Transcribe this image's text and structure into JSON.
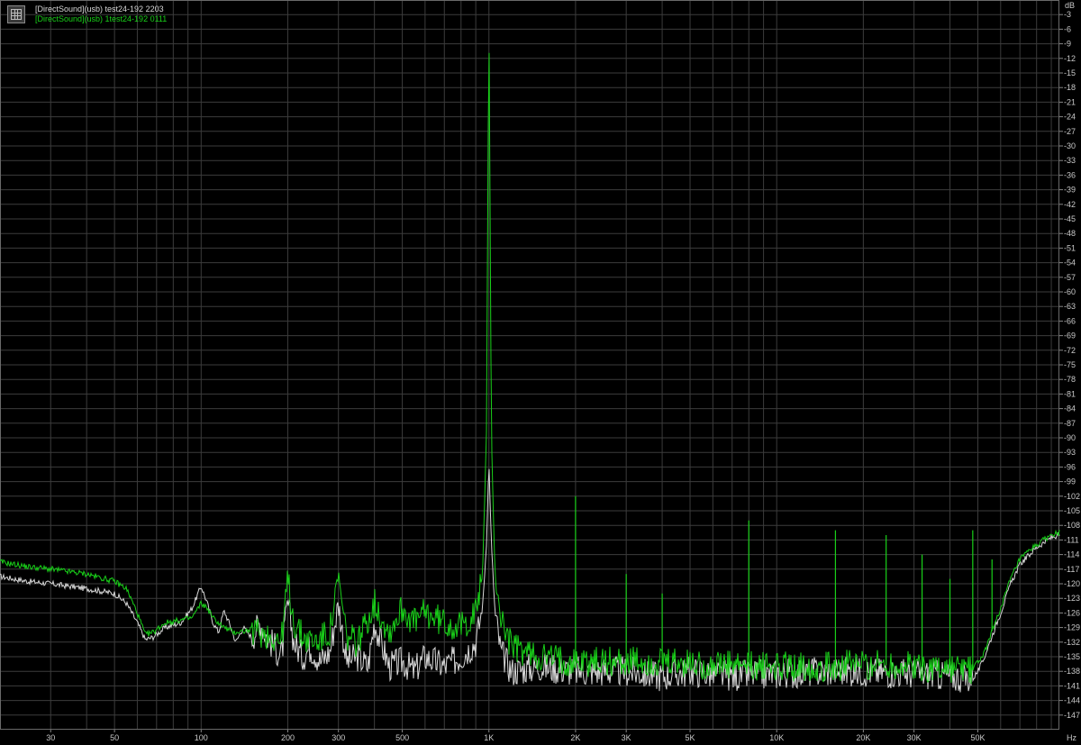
{
  "legend": {
    "series0": "[DirectSound](usb) test24-192 2203",
    "series1": "[DirectSound](usb) 1test24-192 0111"
  },
  "chart_data": {
    "type": "line",
    "xscale": "log",
    "xlim": [
      20,
      96000
    ],
    "ylim": [
      -150,
      0
    ],
    "grid": true,
    "legend_position": "top-left",
    "x_unit": "Hz",
    "y_unit": "dB",
    "x_ticks": [
      30,
      50,
      100,
      200,
      300,
      500,
      1000,
      2000,
      3000,
      5000,
      10000,
      20000,
      30000,
      50000
    ],
    "x_tick_labels": [
      "30",
      "50",
      "100",
      "200",
      "300",
      "500",
      "1K",
      "2K",
      "3K",
      "5K",
      "10K",
      "20K",
      "30K",
      "50K"
    ],
    "y_ticks": [
      -3,
      -6,
      -9,
      -12,
      -15,
      -18,
      -21,
      -24,
      -27,
      -30,
      -33,
      -36,
      -39,
      -42,
      -45,
      -48,
      -51,
      -54,
      -57,
      -60,
      -63,
      -66,
      -69,
      -72,
      -75,
      -78,
      -81,
      -84,
      -87,
      -90,
      -93,
      -96,
      -99,
      -102,
      -105,
      -108,
      -111,
      -114,
      -117,
      -120,
      -123,
      -126,
      -129,
      -132,
      -135,
      -138,
      -141,
      -144,
      -147
    ],
    "series": [
      {
        "name": "[DirectSound](usb) test24-192 2203",
        "color": "#d8d8d8",
        "points": [
          [
            20,
            -118.5
          ],
          [
            25,
            -119.5
          ],
          [
            30,
            -120
          ],
          [
            40,
            -121
          ],
          [
            50,
            -122
          ],
          [
            55,
            -124
          ],
          [
            60,
            -128
          ],
          [
            64,
            -131.5
          ],
          [
            68,
            -131
          ],
          [
            75,
            -129
          ],
          [
            85,
            -128
          ],
          [
            93,
            -125
          ],
          [
            100,
            -120.5
          ],
          [
            105,
            -124
          ],
          [
            110,
            -128
          ],
          [
            115,
            -130
          ],
          [
            120,
            -125.5
          ],
          [
            125,
            -128
          ],
          [
            132,
            -132
          ],
          [
            140,
            -129
          ],
          [
            150,
            -131
          ],
          [
            160,
            -128
          ],
          [
            170,
            -131
          ],
          [
            180,
            -133
          ],
          [
            190,
            -135
          ],
          [
            200,
            -124
          ],
          [
            210,
            -132
          ],
          [
            225,
            -135
          ],
          [
            240,
            -133
          ],
          [
            260,
            -136
          ],
          [
            280,
            -134
          ],
          [
            300,
            -124
          ],
          [
            320,
            -136
          ],
          [
            350,
            -135
          ],
          [
            380,
            -137
          ],
          [
            400,
            -128
          ],
          [
            450,
            -137
          ],
          [
            500,
            -136
          ],
          [
            550,
            -138
          ],
          [
            600,
            -135
          ],
          [
            700,
            -137
          ],
          [
            800,
            -135
          ],
          [
            900,
            -132
          ],
          [
            950,
            -125
          ],
          [
            980,
            -112
          ],
          [
            1000,
            -95
          ],
          [
            1020,
            -112
          ],
          [
            1050,
            -126
          ],
          [
            1100,
            -134
          ],
          [
            1200,
            -138
          ],
          [
            1500,
            -137
          ],
          [
            2000,
            -138
          ],
          [
            3000,
            -138
          ],
          [
            4000,
            -139
          ],
          [
            5000,
            -138
          ],
          [
            7000,
            -139
          ],
          [
            10000,
            -138.5
          ],
          [
            15000,
            -138
          ],
          [
            20000,
            -138
          ],
          [
            30000,
            -138.5
          ],
          [
            40000,
            -139
          ],
          [
            48000,
            -139.5
          ],
          [
            50000,
            -138
          ],
          [
            52000,
            -136
          ],
          [
            55000,
            -132
          ],
          [
            60000,
            -126
          ],
          [
            65000,
            -120
          ],
          [
            70000,
            -116
          ],
          [
            80000,
            -112.5
          ],
          [
            90000,
            -110.5
          ],
          [
            96000,
            -110
          ]
        ]
      },
      {
        "name": "[DirectSound](usb) 1test24-192 0111",
        "color": "#19d019",
        "points": [
          [
            20,
            -115.5
          ],
          [
            25,
            -116.5
          ],
          [
            30,
            -117
          ],
          [
            40,
            -118
          ],
          [
            50,
            -119.5
          ],
          [
            55,
            -121
          ],
          [
            60,
            -126
          ],
          [
            64,
            -130.5
          ],
          [
            68,
            -130
          ],
          [
            75,
            -128
          ],
          [
            85,
            -127.5
          ],
          [
            93,
            -127
          ],
          [
            100,
            -124
          ],
          [
            105,
            -125
          ],
          [
            110,
            -127
          ],
          [
            120,
            -129
          ],
          [
            130,
            -130
          ],
          [
            150,
            -129.5
          ],
          [
            160,
            -130
          ],
          [
            170,
            -130.5
          ],
          [
            180,
            -131
          ],
          [
            190,
            -132
          ],
          [
            200,
            -119
          ],
          [
            210,
            -128
          ],
          [
            225,
            -131
          ],
          [
            250,
            -132
          ],
          [
            280,
            -130
          ],
          [
            300,
            -119
          ],
          [
            320,
            -131
          ],
          [
            350,
            -132
          ],
          [
            400,
            -124
          ],
          [
            450,
            -130
          ],
          [
            500,
            -125
          ],
          [
            550,
            -128
          ],
          [
            600,
            -126
          ],
          [
            700,
            -128
          ],
          [
            800,
            -129
          ],
          [
            900,
            -126
          ],
          [
            950,
            -118
          ],
          [
            980,
            -90
          ],
          [
            1000,
            -3
          ],
          [
            1020,
            -90
          ],
          [
            1050,
            -118
          ],
          [
            1100,
            -127
          ],
          [
            1200,
            -133
          ],
          [
            1500,
            -135
          ],
          [
            2000,
            -136
          ],
          [
            3000,
            -136
          ],
          [
            4000,
            -136.5
          ],
          [
            5000,
            -136.5
          ],
          [
            7000,
            -137
          ],
          [
            10000,
            -137
          ],
          [
            15000,
            -137
          ],
          [
            20000,
            -136.5
          ],
          [
            30000,
            -137
          ],
          [
            40000,
            -137.5
          ],
          [
            48000,
            -137.5
          ],
          [
            50000,
            -136
          ],
          [
            52000,
            -135
          ],
          [
            55000,
            -131
          ],
          [
            60000,
            -125
          ],
          [
            65000,
            -119
          ],
          [
            70000,
            -115
          ],
          [
            80000,
            -112
          ],
          [
            90000,
            -110
          ],
          [
            96000,
            -109.5
          ]
        ]
      }
    ],
    "spikes": [
      {
        "series": 1,
        "x": 2000,
        "y": -102
      },
      {
        "series": 1,
        "x": 3000,
        "y": -118
      },
      {
        "series": 1,
        "x": 4000,
        "y": -122
      },
      {
        "series": 1,
        "x": 8000,
        "y": -107
      },
      {
        "series": 1,
        "x": 16000,
        "y": -109
      },
      {
        "series": 1,
        "x": 24000,
        "y": -110
      },
      {
        "series": 1,
        "x": 32000,
        "y": -114
      },
      {
        "series": 1,
        "x": 40000,
        "y": -119
      },
      {
        "series": 1,
        "x": 48000,
        "y": -109
      },
      {
        "series": 1,
        "x": 56000,
        "y": -115
      },
      {
        "series": 0,
        "x": 1000,
        "y": -95
      },
      {
        "series": 0,
        "x": 100,
        "y": -120.5
      },
      {
        "series": 0,
        "x": 300,
        "y": -124
      }
    ]
  }
}
